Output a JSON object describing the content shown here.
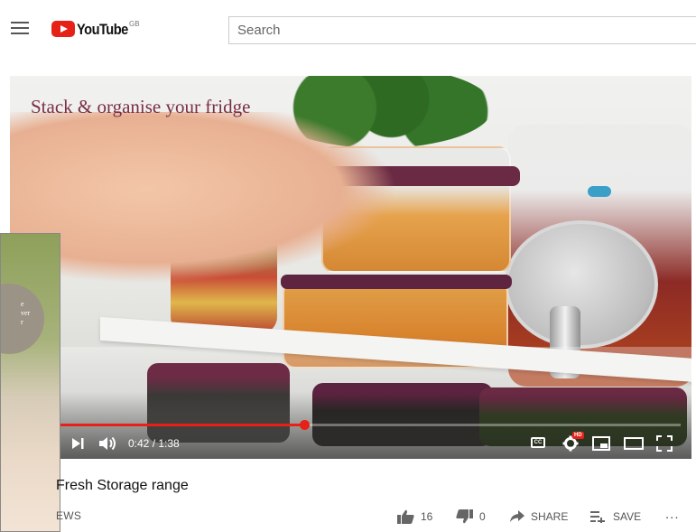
{
  "header": {
    "logo_text": "YouTube",
    "region": "GB",
    "search_placeholder": "Search"
  },
  "video": {
    "overlay_title": "Stack & organise your fridge",
    "current_time": "0:42",
    "duration": "1:38",
    "time_display": "0:42 / 1:38",
    "progress": 0.43,
    "quality_badge": "HD",
    "cc_label": "CC"
  },
  "info": {
    "title_partial": "Fresh Storage range",
    "views_partial": "EWS",
    "likes": "16",
    "dislikes": "0",
    "share_label": "SHARE",
    "save_label": "SAVE",
    "more_label": "..."
  },
  "colors": {
    "brand_red": "#e62117",
    "overlay_text": "#7a2e45"
  },
  "icons": [
    "menu-icon",
    "youtube-logo-icon",
    "play-next-icon",
    "volume-icon",
    "subtitles-icon",
    "settings-icon",
    "miniplayer-icon",
    "theater-icon",
    "fullscreen-icon",
    "thumbs-up-icon",
    "thumbs-down-icon",
    "share-arrow-icon",
    "add-to-playlist-icon",
    "more-icon"
  ]
}
